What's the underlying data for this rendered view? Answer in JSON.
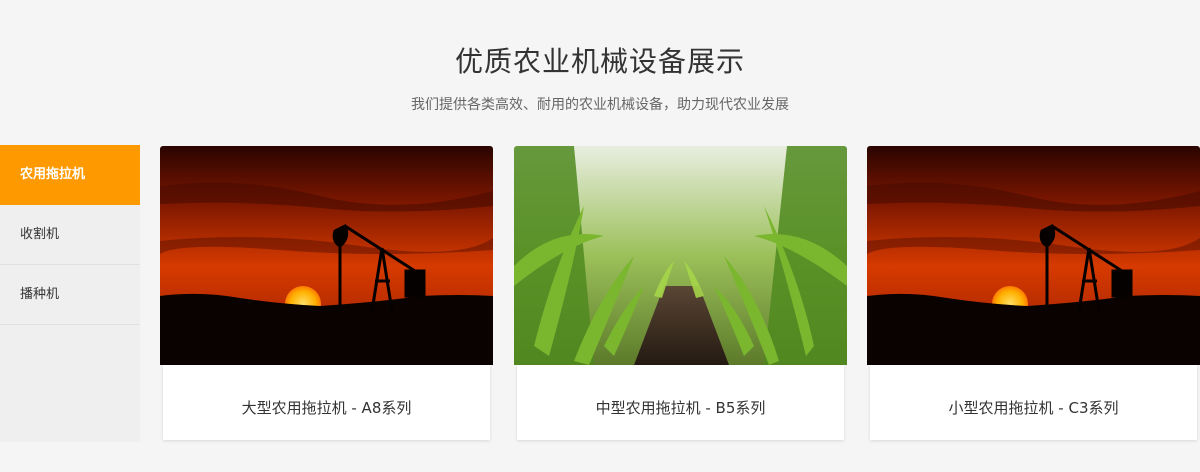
{
  "header": {
    "title": "优质农业机械设备展示",
    "subtitle": "我们提供各类高效、耐用的农业机械设备，助力现代农业发展"
  },
  "sidebar": {
    "items": [
      {
        "label": "农用拖拉机",
        "active": true
      },
      {
        "label": "收割机",
        "active": false
      },
      {
        "label": "播种机",
        "active": false
      }
    ]
  },
  "products": [
    {
      "name": "大型农用拖拉机 - A8系列",
      "image": "sunset-oil-pump-image"
    },
    {
      "name": "中型农用拖拉机 - B5系列",
      "image": "corn-field-image"
    },
    {
      "name": "小型农用拖拉机 - C3系列",
      "image": "sunset-oil-pump-image"
    }
  ],
  "colors": {
    "accent": "#ff9900",
    "background": "#f5f5f5",
    "sidebar_bg": "#efefef"
  }
}
